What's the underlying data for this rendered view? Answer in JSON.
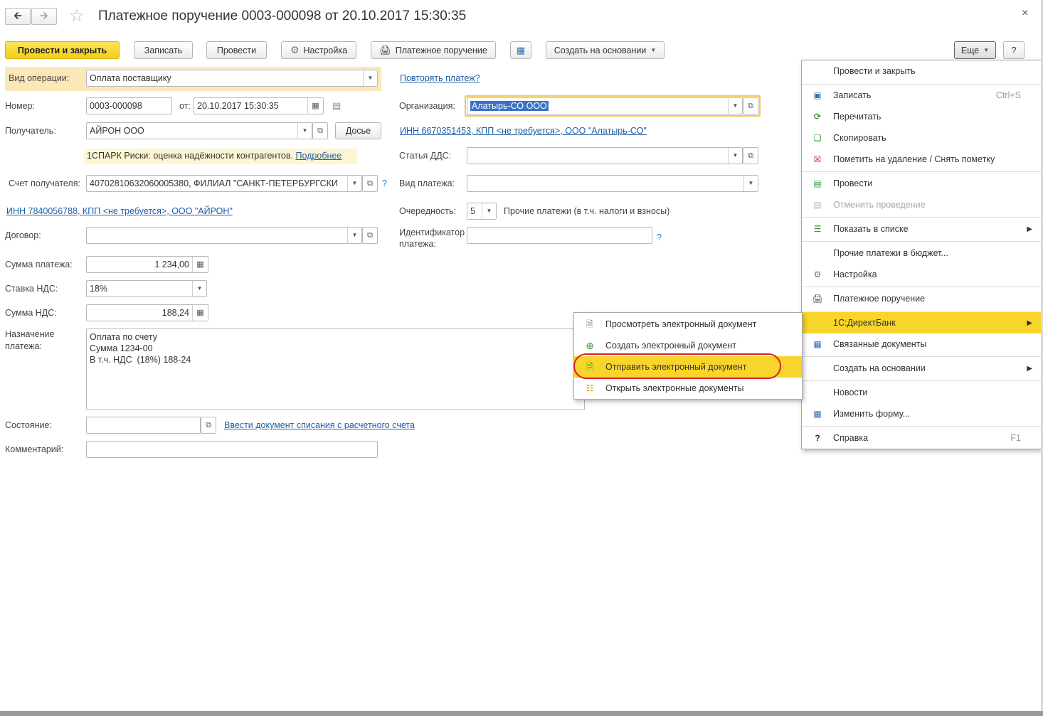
{
  "window": {
    "back_icon": "arrow-left-icon",
    "forward_icon": "arrow-right-icon",
    "title": "Платежное поручение 0003-000098 от 20.10.2017 15:30:35",
    "close_glyph": "×"
  },
  "toolbar": {
    "post_close": "Провести и закрыть",
    "save": "Записать",
    "post": "Провести",
    "settings": "Настройка",
    "print_payment": "Платежное поручение",
    "create_based": "Создать на основании",
    "more": "Еще",
    "help": "?"
  },
  "form": {
    "op_type_label": "Вид операции:",
    "op_type_value": "Оплата поставщику",
    "repeat_link": "Повторять платеж?",
    "number_label": "Номер:",
    "number_value": "0003-000098",
    "date_label": "от:",
    "date_value": "20.10.2017 15:30:35",
    "org_label": "Организация:",
    "org_value": "Алатырь-СО ООО",
    "recipient_label": "Получатель:",
    "recipient_value": "АЙРОН ООО",
    "dossier_button": "Досье",
    "org_inn_link": "ИНН 6670351453, КПП <не требуется>, ООО \"Алатырь-СО\"",
    "spark_text": "1СПАРК Риски: оценка надёжности контрагентов.",
    "spark_link": "Подробнее",
    "dds_label": "Статья ДДС:",
    "dds_value": "",
    "account_label": "Счет получателя:",
    "account_value": "40702810632060005380, ФИЛИАЛ \"САНКТ-ПЕТЕРБУРГСКИ",
    "account_help": "?",
    "pay_kind_label": "Вид платежа:",
    "pay_kind_value": "",
    "recipient_inn_link": "ИНН 7840056788, КПП <не требуется>, ООО \"АЙРОН\"",
    "priority_label": "Очередность:",
    "priority_value": "5",
    "priority_text": "Прочие платежи (в т.ч. налоги и взносы)",
    "contract_label": "Договор:",
    "contract_value": "",
    "identifier_label_1": "Идентификатор",
    "identifier_label_2": "платежа:",
    "identifier_value": "",
    "identifier_help": "?",
    "sum_label": "Сумма платежа:",
    "sum_value": "1 234,00",
    "vat_rate_label": "Ставка НДС:",
    "vat_rate_value": "18%",
    "vat_sum_label": "Сумма НДС:",
    "vat_sum_value": "188,24",
    "purpose_label_1": "Назначение",
    "purpose_label_2": "платежа:",
    "purpose_value": "Оплата по счету\nСумма 1234-00\nВ т.ч. НДС  (18%) 188-24",
    "state_label": "Состояние:",
    "state_value": "",
    "state_link": "Ввести документ списания с расчетного счета",
    "comment_label": "Комментарий:",
    "comment_value": ""
  },
  "more_menu": {
    "items": [
      {
        "label": "Провести и закрыть",
        "icon": "none",
        "shortcut": ""
      },
      {
        "label": "Записать",
        "icon": "floppy-icon",
        "shortcut": "Ctrl+S"
      },
      {
        "label": "Перечитать",
        "icon": "refresh-icon",
        "shortcut": ""
      },
      {
        "label": "Скопировать",
        "icon": "copy-icon",
        "shortcut": ""
      },
      {
        "label": "Пометить на удаление / Снять пометку",
        "icon": "delete-mark-icon",
        "shortcut": ""
      },
      {
        "label": "Провести",
        "icon": "post-document-icon",
        "shortcut": ""
      },
      {
        "label": "Отменить проведение",
        "icon": "unpost-document-icon",
        "shortcut": ""
      },
      {
        "label": "Показать в списке",
        "icon": "list-icon",
        "shortcut": ""
      },
      {
        "label": "Прочие платежи в бюджет...",
        "icon": "none",
        "shortcut": ""
      },
      {
        "label": "Настройка",
        "icon": "gear-icon",
        "shortcut": ""
      },
      {
        "label": "Платежное поручение",
        "icon": "printer-icon",
        "shortcut": ""
      },
      {
        "label": "1С:ДиректБанк",
        "icon": "none",
        "shortcut": ""
      },
      {
        "label": "Связанные документы",
        "icon": "structure-icon",
        "shortcut": ""
      },
      {
        "label": "Создать на основании",
        "icon": "none",
        "shortcut": ""
      },
      {
        "label": "Новости",
        "icon": "none",
        "shortcut": ""
      },
      {
        "label": "Изменить форму...",
        "icon": "form-settings-icon",
        "shortcut": ""
      },
      {
        "label": "Справка",
        "icon": "help-icon",
        "shortcut": "F1"
      }
    ]
  },
  "submenu": {
    "items": [
      {
        "label": "Просмотреть электронный документ",
        "icon": "document-icon"
      },
      {
        "label": "Создать электронный документ",
        "icon": "plus-circle-icon"
      },
      {
        "label": "Отправить электронный документ",
        "icon": "send-document-icon"
      },
      {
        "label": "Открыть электронные документы",
        "icon": "hierarchy-icon"
      }
    ]
  },
  "colors": {
    "accent_yellow": "#f8d52a",
    "link_blue": "#1f5ea8",
    "highlight_ring": "#d71f2a",
    "selection_blue": "#3a72c4"
  }
}
